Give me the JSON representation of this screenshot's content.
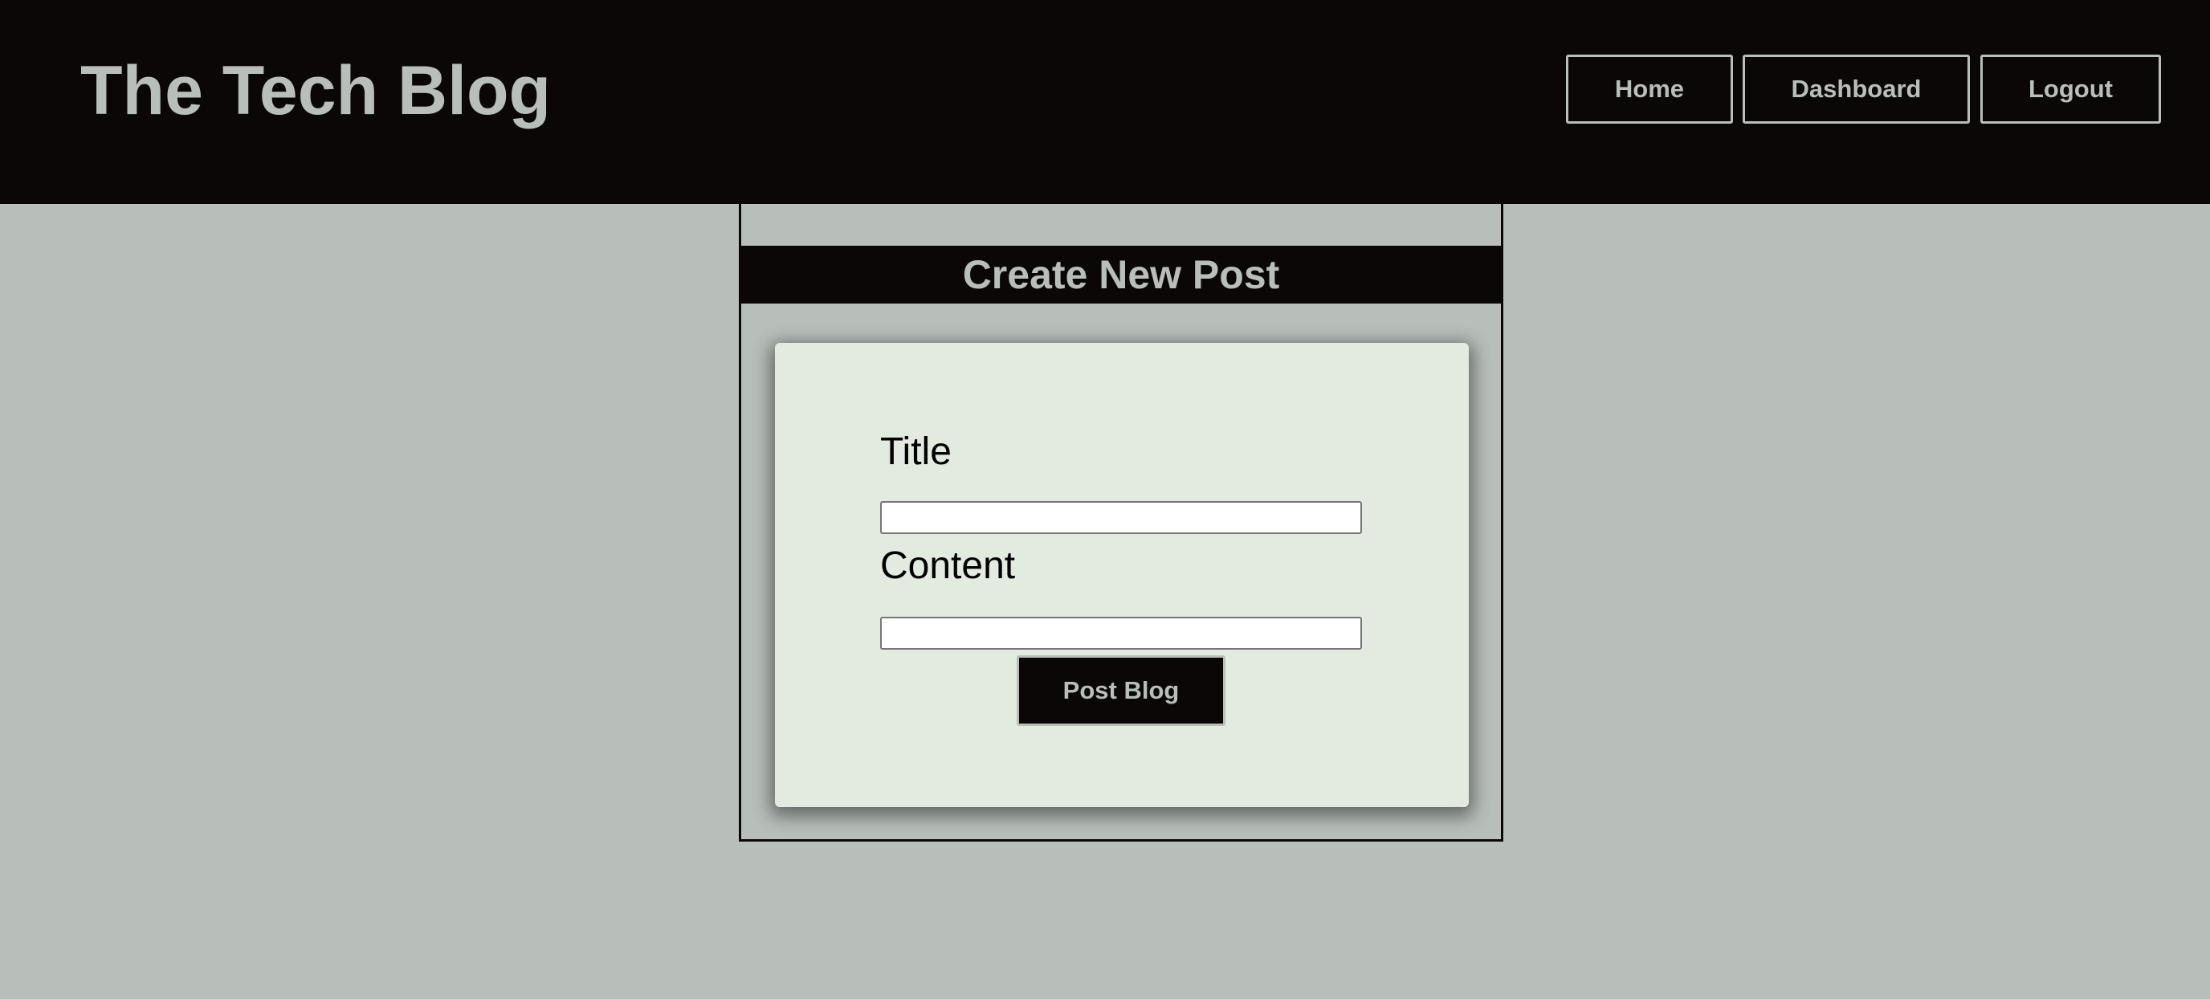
{
  "header": {
    "site_title": "The Tech Blog",
    "nav": {
      "home": "Home",
      "dashboard": "Dashboard",
      "logout": "Logout"
    }
  },
  "panel": {
    "heading": "Create New Post",
    "form": {
      "title_label": "Title",
      "title_value": "",
      "content_label": "Content",
      "content_value": "",
      "submit_label": "Post Blog"
    }
  },
  "colors": {
    "header_background": "#0b0707",
    "page_background": "#b8bfbb",
    "card_background": "#e3ebe1",
    "accent_text": "#b8bfbb"
  }
}
